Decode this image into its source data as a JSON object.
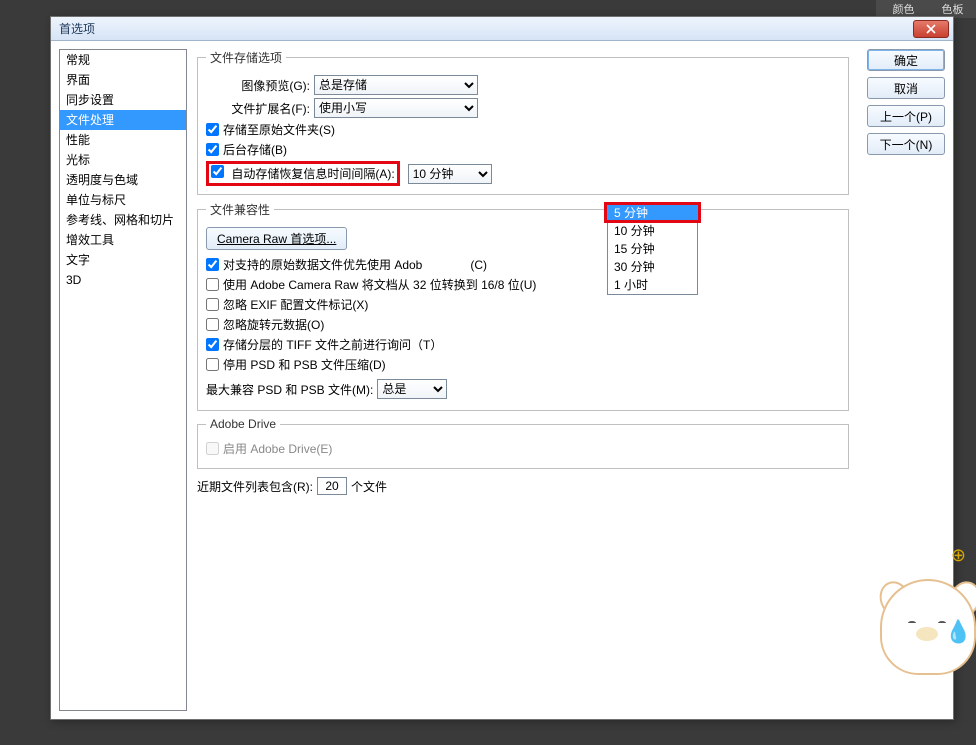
{
  "behind": {
    "t1": "颜色",
    "t2": "色板"
  },
  "dialog": {
    "title": "首选项",
    "ok": "确定",
    "cancel": "取消",
    "prev": "上一个(P)",
    "next": "下一个(N)"
  },
  "sidebar": {
    "items": [
      "常规",
      "界面",
      "同步设置",
      "文件处理",
      "性能",
      "光标",
      "透明度与色域",
      "单位与标尺",
      "参考线、网格和切片",
      "增效工具",
      "文字",
      "3D"
    ],
    "selected_index": 3
  },
  "save_opts": {
    "legend": "文件存储选项",
    "preview_label": "图像预览(G):",
    "preview_value": "总是存储",
    "ext_label": "文件扩展名(F):",
    "ext_value": "使用小写",
    "save_orig": "存储至原始文件夹(S)",
    "bg_save": "后台存储(B)",
    "autosave_label": "自动存储恢复信息时间间隔(A):",
    "autosave_value": "10 分钟",
    "interval_options": [
      "5 分钟",
      "10 分钟",
      "15 分钟",
      "30 分钟",
      "1 小时"
    ],
    "interval_selected_index": 0
  },
  "compat": {
    "legend": "文件兼容性",
    "camera_btn": "Camera Raw 首选项...",
    "prefer_raw": "对支持的原始数据文件优先使用 Adob",
    "prefer_raw_suffix": "(C)",
    "use_raw_1632": "使用 Adobe Camera Raw 将文档从 32 位转换到 16/8 位(U)",
    "ignore_exif": "忽略 EXIF 配置文件标记(X)",
    "ignore_rot": "忽略旋转元数据(O)",
    "ask_tiff": "存储分层的 TIFF 文件之前进行询问（T）",
    "disable_psd": "停用 PSD 和 PSB 文件压缩(D)",
    "max_compat_label": "最大兼容 PSD 和 PSB 文件(M):",
    "max_compat_value": "总是"
  },
  "drive": {
    "legend": "Adobe Drive",
    "enable": "启用 Adobe Drive(E)"
  },
  "recent": {
    "label_a": "近期文件列表包含(R):",
    "value": "20",
    "label_b": "个文件"
  }
}
